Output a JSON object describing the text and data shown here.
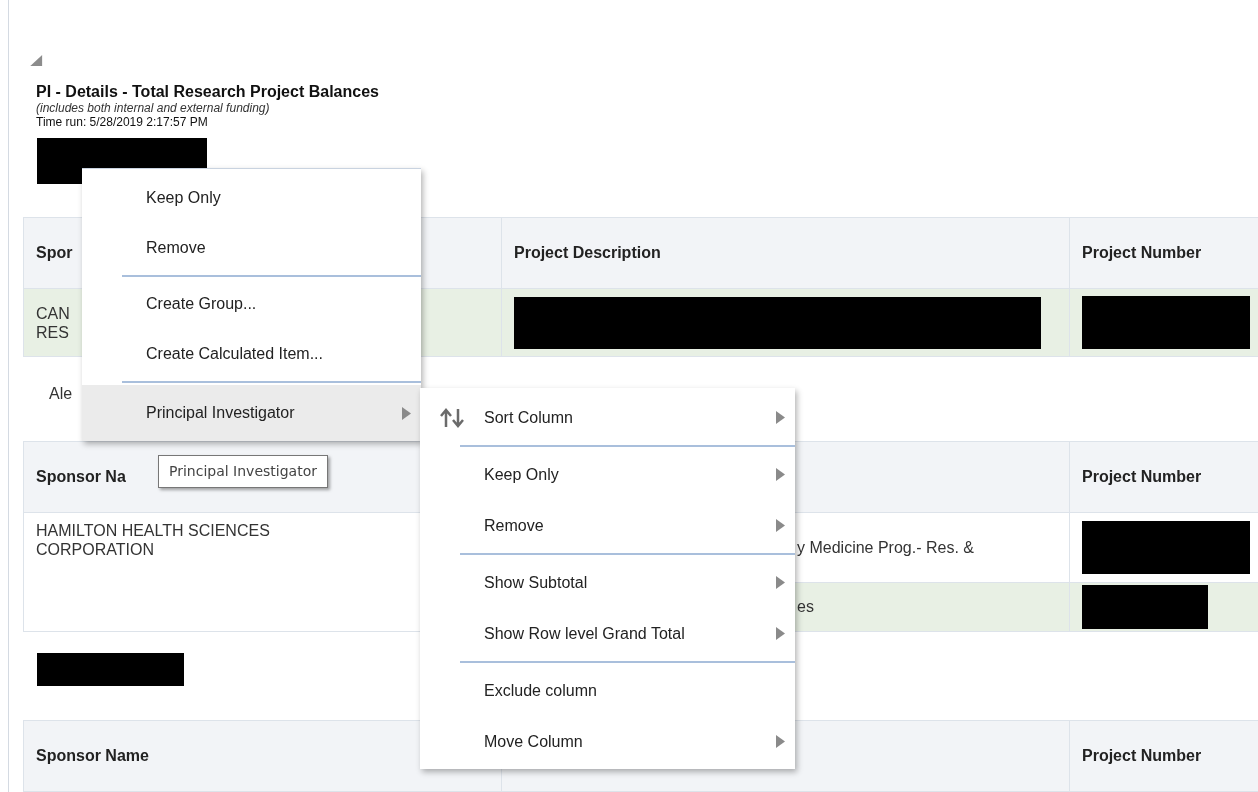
{
  "report_header": {
    "title": "PI - Details - Total Research Project Balances",
    "subtitle": "(includes both internal and external funding)",
    "time_run": "Time run: 5/28/2019 2:17:57 PM"
  },
  "blocks": [
    {
      "kind": "redacted"
    },
    {
      "kind": "table",
      "columns": [
        {
          "kind": "text",
          "text": "Spor"
        },
        {
          "kind": "text",
          "text": "Project Description"
        },
        {
          "kind": "text",
          "text": "Project Number"
        }
      ],
      "rows": [
        {
          "highlighted": true,
          "cells": [
            {
              "kind": "lines",
              "lines": [
                "CAN",
                "RES"
              ]
            },
            {
              "kind": "redacted"
            },
            {
              "kind": "redacted"
            }
          ]
        }
      ]
    },
    {
      "kind": "label",
      "text": "Ale"
    },
    {
      "kind": "table",
      "columns": [
        {
          "kind": "text",
          "text": "Sponsor Na"
        },
        {
          "kind": "covered"
        },
        {
          "kind": "text",
          "text": "Project Number"
        }
      ],
      "rows": [
        {
          "highlighted": false,
          "cells": [
            {
              "kind": "lines",
              "rowspan": 2,
              "lines": [
                "HAMILTON HEALTH SCIENCES",
                "CORPORATION"
              ]
            },
            {
              "kind": "clipped",
              "text": "y Medicine Prog.- Res. &"
            },
            {
              "kind": "redacted"
            }
          ]
        },
        {
          "highlighted": true,
          "cells": [
            {
              "kind": "clipped",
              "text": "es"
            },
            {
              "kind": "redacted"
            }
          ]
        }
      ]
    },
    {
      "kind": "redacted"
    },
    {
      "kind": "table",
      "columns": [
        {
          "kind": "text",
          "text": "Sponsor Name"
        },
        {
          "kind": "covered"
        },
        {
          "kind": "text",
          "text": "Project Number"
        }
      ]
    }
  ],
  "context_menu": {
    "items": [
      {
        "kind": "item",
        "label": "Keep Only",
        "highlighted": false,
        "submenu": false
      },
      {
        "kind": "item",
        "label": "Remove",
        "highlighted": false,
        "submenu": false
      },
      {
        "kind": "separator"
      },
      {
        "kind": "item",
        "label": "Create Group...",
        "highlighted": false,
        "submenu": false
      },
      {
        "kind": "item",
        "label": "Create Calculated Item...",
        "highlighted": false,
        "submenu": false
      },
      {
        "kind": "separator"
      },
      {
        "kind": "item",
        "label": "Principal Investigator",
        "highlighted": true,
        "submenu": true
      }
    ]
  },
  "tooltip": {
    "text": "Principal Investigator"
  },
  "submenu": {
    "items": [
      {
        "kind": "icon_item",
        "label": "Sort Column",
        "submenu": true
      },
      {
        "kind": "separator"
      },
      {
        "kind": "item",
        "label": "Keep Only",
        "submenu": true
      },
      {
        "kind": "item",
        "label": "Remove",
        "submenu": true
      },
      {
        "kind": "separator"
      },
      {
        "kind": "item",
        "label": "Show Subtotal",
        "submenu": true
      },
      {
        "kind": "item",
        "label": "Show Row level Grand Total",
        "submenu": true
      },
      {
        "kind": "separator"
      },
      {
        "kind": "item",
        "label": "Exclude column",
        "submenu": false
      },
      {
        "kind": "item",
        "label": "Move Column",
        "submenu": true
      }
    ]
  }
}
